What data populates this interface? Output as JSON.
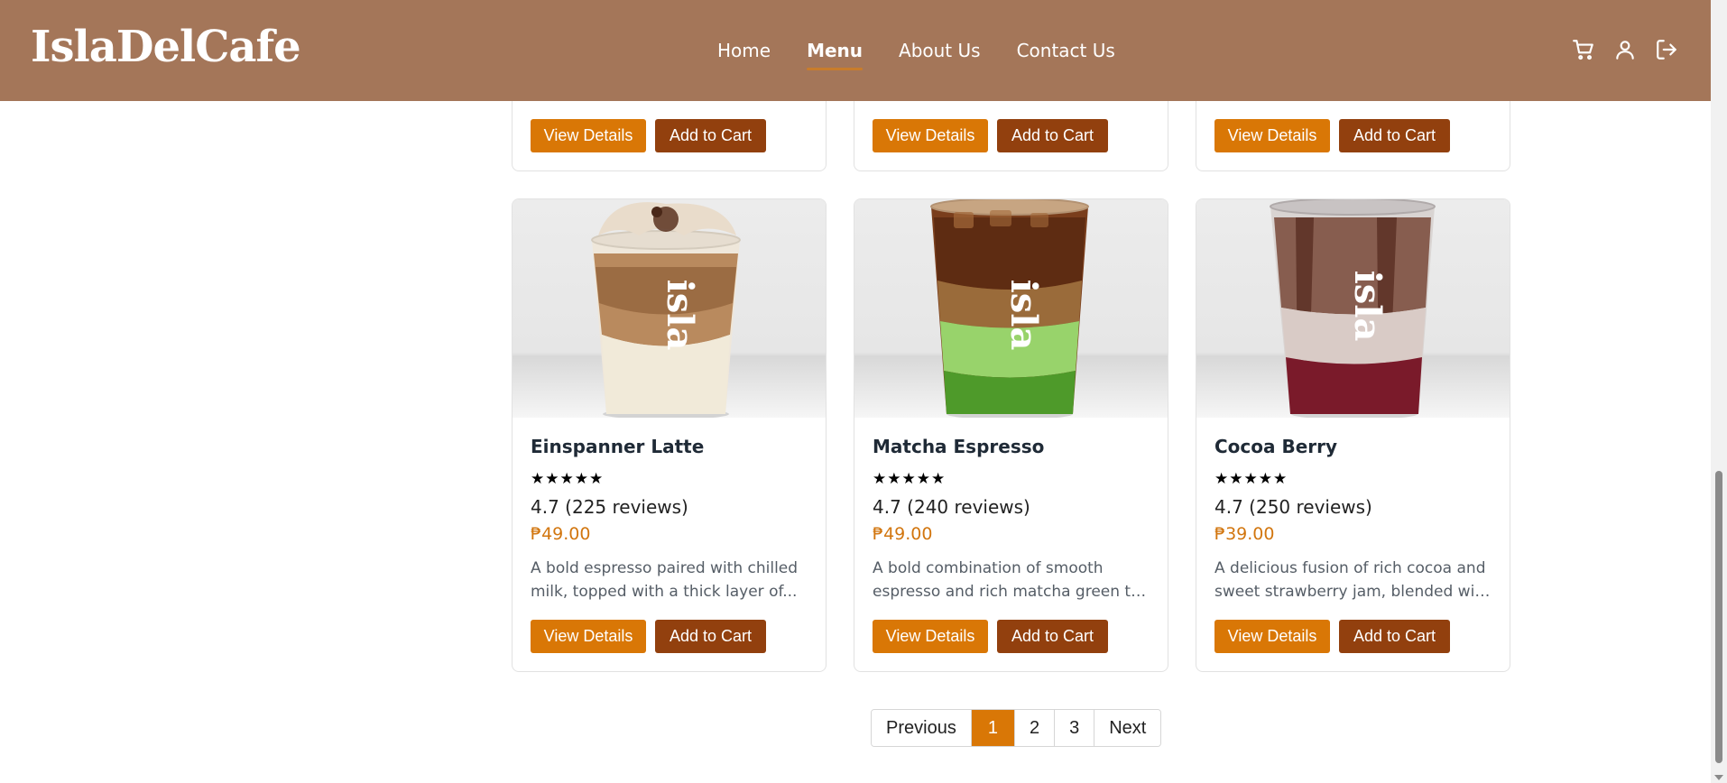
{
  "brand": {
    "logo": "IslaDelCafe"
  },
  "nav": {
    "links": [
      {
        "label": "Home",
        "active": false
      },
      {
        "label": "Menu",
        "active": true
      },
      {
        "label": "About Us",
        "active": false
      },
      {
        "label": "Contact Us",
        "active": false
      }
    ],
    "icons": [
      "cart-icon",
      "user-icon",
      "logout-icon"
    ]
  },
  "colors": {
    "navbar": "#a47659",
    "accent": "#d97706",
    "cart_button": "#92400e",
    "price": "#d2760f"
  },
  "top_row_cards": [
    {
      "details_label": "View Details",
      "cart_label": "Add to Cart"
    },
    {
      "details_label": "View Details",
      "cart_label": "Add to Cart"
    },
    {
      "details_label": "View Details",
      "cart_label": "Add to Cart"
    }
  ],
  "products": [
    {
      "name": "Einspanner Latte",
      "stars": "★★★★★",
      "rating": 4.7,
      "rating_text": "4.7 (225 reviews)",
      "price": "₱49.00",
      "desc_line1": "A bold espresso paired with chilled",
      "desc_line2": "milk, topped with a thick layer of...",
      "details_label": "View Details",
      "cart_label": "Add to Cart"
    },
    {
      "name": "Matcha Espresso",
      "stars": "★★★★★",
      "rating": 4.7,
      "rating_text": "4.7 (240 reviews)",
      "price": "₱49.00",
      "desc_line1": "A bold combination of smooth",
      "desc_line2": "espresso and rich matcha green tea...",
      "details_label": "View Details",
      "cart_label": "Add to Cart"
    },
    {
      "name": "Cocoa Berry",
      "stars": "★★★★★",
      "rating": 4.7,
      "rating_text": "4.7 (250 reviews)",
      "price": "₱39.00",
      "desc_line1": "A delicious fusion of rich cocoa and",
      "desc_line2": "sweet strawberry jam, blended with...",
      "details_label": "View Details",
      "cart_label": "Add to Cart"
    }
  ],
  "pagination": {
    "previous": "Previous",
    "pages": [
      "1",
      "2",
      "3"
    ],
    "current": "1",
    "next": "Next"
  },
  "image_text": "isla"
}
